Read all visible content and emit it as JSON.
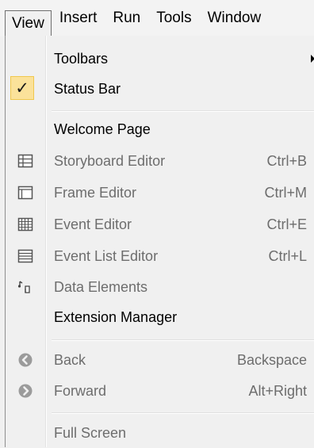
{
  "menubar": {
    "items": [
      "View",
      "Insert",
      "Run",
      "Tools",
      "Window"
    ]
  },
  "menu": {
    "toolbars": {
      "label": "Toolbars"
    },
    "status_bar": {
      "label": "Status Bar",
      "checked": true
    },
    "welcome_page": {
      "label": "Welcome Page"
    },
    "storyboard_editor": {
      "label": "Storyboard Editor",
      "shortcut": "Ctrl+B"
    },
    "frame_editor": {
      "label": "Frame Editor",
      "shortcut": "Ctrl+M"
    },
    "event_editor": {
      "label": "Event Editor",
      "shortcut": "Ctrl+E"
    },
    "event_list_editor": {
      "label": "Event List Editor",
      "shortcut": "Ctrl+L"
    },
    "data_elements": {
      "label": "Data Elements"
    },
    "extension_manager": {
      "label": "Extension Manager"
    },
    "back": {
      "label": "Back",
      "shortcut": "Backspace"
    },
    "forward": {
      "label": "Forward",
      "shortcut": "Alt+Right"
    },
    "full_screen": {
      "label": "Full Screen"
    }
  },
  "colors": {
    "menu_bg": "#f0f0f0",
    "check_bg": "#fbe29a",
    "disabled_text": "#6d6d6d"
  }
}
